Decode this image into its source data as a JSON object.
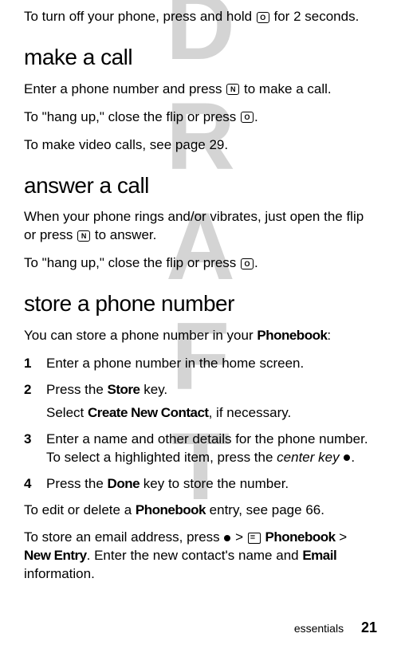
{
  "watermark": "DRAFT",
  "intro": {
    "text_before": "To turn off your phone, press and hold ",
    "text_after": " for 2 seconds."
  },
  "sections": {
    "make_call": {
      "heading": "make a call",
      "p1_before": "Enter a phone number and press ",
      "p1_after": " to make a call.",
      "p2_before": "To \"hang up,\" close the flip or press ",
      "p2_after": ".",
      "p3": "To make video calls, see page 29."
    },
    "answer_call": {
      "heading": "answer a call",
      "p1_before": "When your phone rings and/or vibrates, just open the flip or press ",
      "p1_after": " to answer.",
      "p2_before": "To \"hang up,\" close the flip or press ",
      "p2_after": "."
    },
    "store_number": {
      "heading": "store a phone number",
      "intro_before": "You can store a phone number in your ",
      "intro_bold": "Phonebook",
      "intro_after": ":",
      "steps": [
        {
          "num": "1",
          "text": "Enter a phone number in the home screen."
        },
        {
          "num": "2",
          "text_before": "Press the ",
          "bold": "Store",
          "text_after": " key.",
          "sub_before": "Select ",
          "sub_bold": "Create New Contact",
          "sub_after": ", if necessary."
        },
        {
          "num": "3",
          "text_before": "Enter a name and other details for the phone number. To select a highlighted item, press the ",
          "italic": "center key",
          "text_after": " ",
          "has_dot": true,
          "dot_after": "."
        },
        {
          "num": "4",
          "text_before": "Press the ",
          "bold": "Done",
          "text_after": " key to store the number."
        }
      ],
      "out1_before": "To edit or delete a ",
      "out1_bold": "Phonebook",
      "out1_after": " entry, see page 66.",
      "out2_before": "To store an email address, press ",
      "out2_mid1": " > ",
      "out2_bold1": "Phonebook",
      "out2_mid2": " > ",
      "out2_bold2": "New Entry",
      "out2_after1": ". Enter the new contact's name and ",
      "out2_bold3": "Email",
      "out2_after2": " information."
    }
  },
  "footer": {
    "label": "essentials",
    "page": "21"
  },
  "icons": {
    "power": "⏻",
    "send": "📞",
    "end": "⏹"
  }
}
